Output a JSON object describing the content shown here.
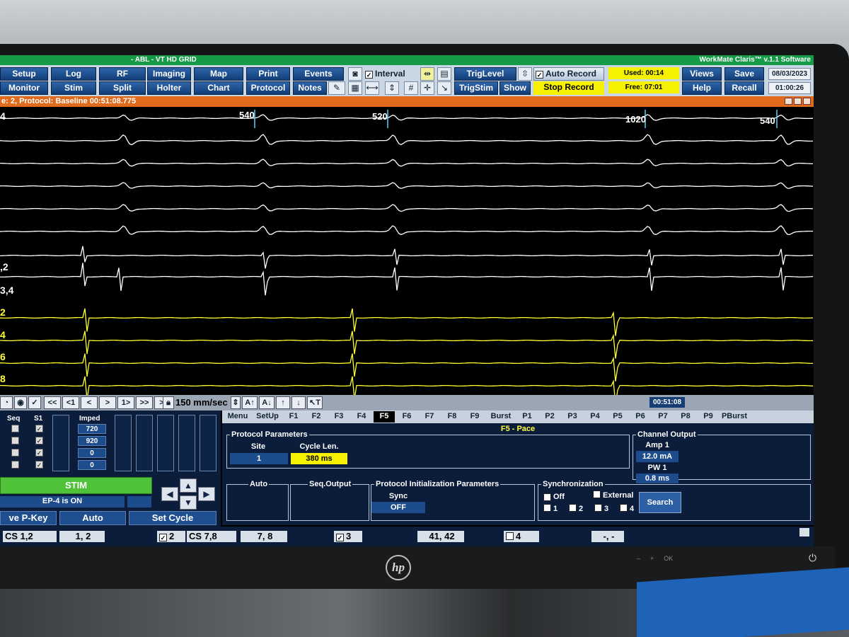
{
  "window": {
    "title": "-  ABL - VT HD GRID",
    "version": "WorkMate Claris™ v.1.1 Software"
  },
  "toolbar": {
    "row1": [
      "Setup",
      "Log",
      "RF",
      "Imaging",
      "Map",
      "Print",
      "Events"
    ],
    "row2": [
      "Monitor",
      "Stim",
      "Split",
      "Holter",
      "Chart",
      "Protocol",
      "Notes"
    ],
    "interval_label": "Interval",
    "triglevel_label": "TrigLevel",
    "trigstim_label": "TrigStim",
    "show_label": "Show",
    "auto_record_label": "Auto Record",
    "stop_record_label": "Stop Record",
    "used": "Used: 00:14",
    "free": "Free: 07:01",
    "views_label": "Views",
    "save_label": "Save",
    "help_label": "Help",
    "recall_label": "Recall",
    "date": "08/03/2023",
    "clock": "01:00:26"
  },
  "protocol_bar": {
    "text": "e: 2, Protocol: Baseline   00:51:08.775"
  },
  "traces": {
    "labels": [
      {
        "text": "4",
        "color": "white"
      },
      {
        "text": ",2",
        "color": "white"
      },
      {
        "text": "3,4",
        "color": "white"
      },
      {
        "text": "2",
        "color": "yellow"
      },
      {
        "text": "4",
        "color": "yellow"
      },
      {
        "text": "6",
        "color": "yellow"
      },
      {
        "text": "8",
        "color": "yellow"
      }
    ],
    "cycle_lengths": [
      "540",
      "520",
      "1020",
      "540"
    ]
  },
  "navbar": {
    "buttons": [
      "<<",
      "<1",
      "<",
      ">",
      "1>",
      ">>",
      ">|"
    ],
    "speed": "150 mm/sec",
    "time": "00:51:08"
  },
  "left_panel": {
    "headers": [
      "Seq",
      "S1",
      "Imped"
    ],
    "impedances": [
      "720",
      "920",
      "0",
      "0"
    ],
    "stim_label": "STIM",
    "ep4_status": "EP-4 is ON",
    "pkey_label": "ve P-Key",
    "auto_label": "Auto",
    "set_cycle_label": "Set Cycle"
  },
  "tabs": [
    "Menu",
    "SetUp",
    "F1",
    "F2",
    "F3",
    "F4",
    "F5",
    "F6",
    "F7",
    "F8",
    "F9",
    "Burst",
    "P1",
    "P2",
    "P3",
    "P4",
    "P5",
    "P6",
    "P7",
    "P8",
    "P9",
    "PBurst"
  ],
  "active_tab": "F5",
  "pace_panel": {
    "title": "F5 - Pace",
    "protocol_parameters_label": "Protocol Parameters",
    "site_label": "Site",
    "site_value": "1",
    "cycle_len_label": "Cycle Len.",
    "cycle_len_value": "380 ms",
    "channel_output_label": "Channel Output",
    "amp_label": "Amp 1",
    "amp_value": "12.0 mA",
    "pw_label": "PW 1",
    "pw_value": "0.8 ms",
    "auto_label": "Auto",
    "seq_output_label": "Seq.Output",
    "init_params_label": "Protocol Initialization Parameters",
    "sync_label": "Sync",
    "sync_value": "OFF",
    "synchronization_label": "Synchronization",
    "off_label": "Off",
    "external_label": "External",
    "sync_options": [
      "1",
      "2",
      "3",
      "4"
    ],
    "search_label": "Search"
  },
  "status_row": [
    "CS 1,2",
    "1,  2",
    "2",
    "CS 7,8",
    "7,  8",
    "3",
    "41, 42",
    "4",
    "-, -"
  ],
  "monitor": {
    "brand": "hp",
    "buttons": [
      "–",
      "+",
      "OK"
    ]
  },
  "colors": {
    "title_green": "#159a48",
    "orange_bar": "#e06b1c",
    "trace_yellow": "#ffff30",
    "stim_green": "#4fc23a",
    "panel_navy": "#0b1d3b"
  }
}
